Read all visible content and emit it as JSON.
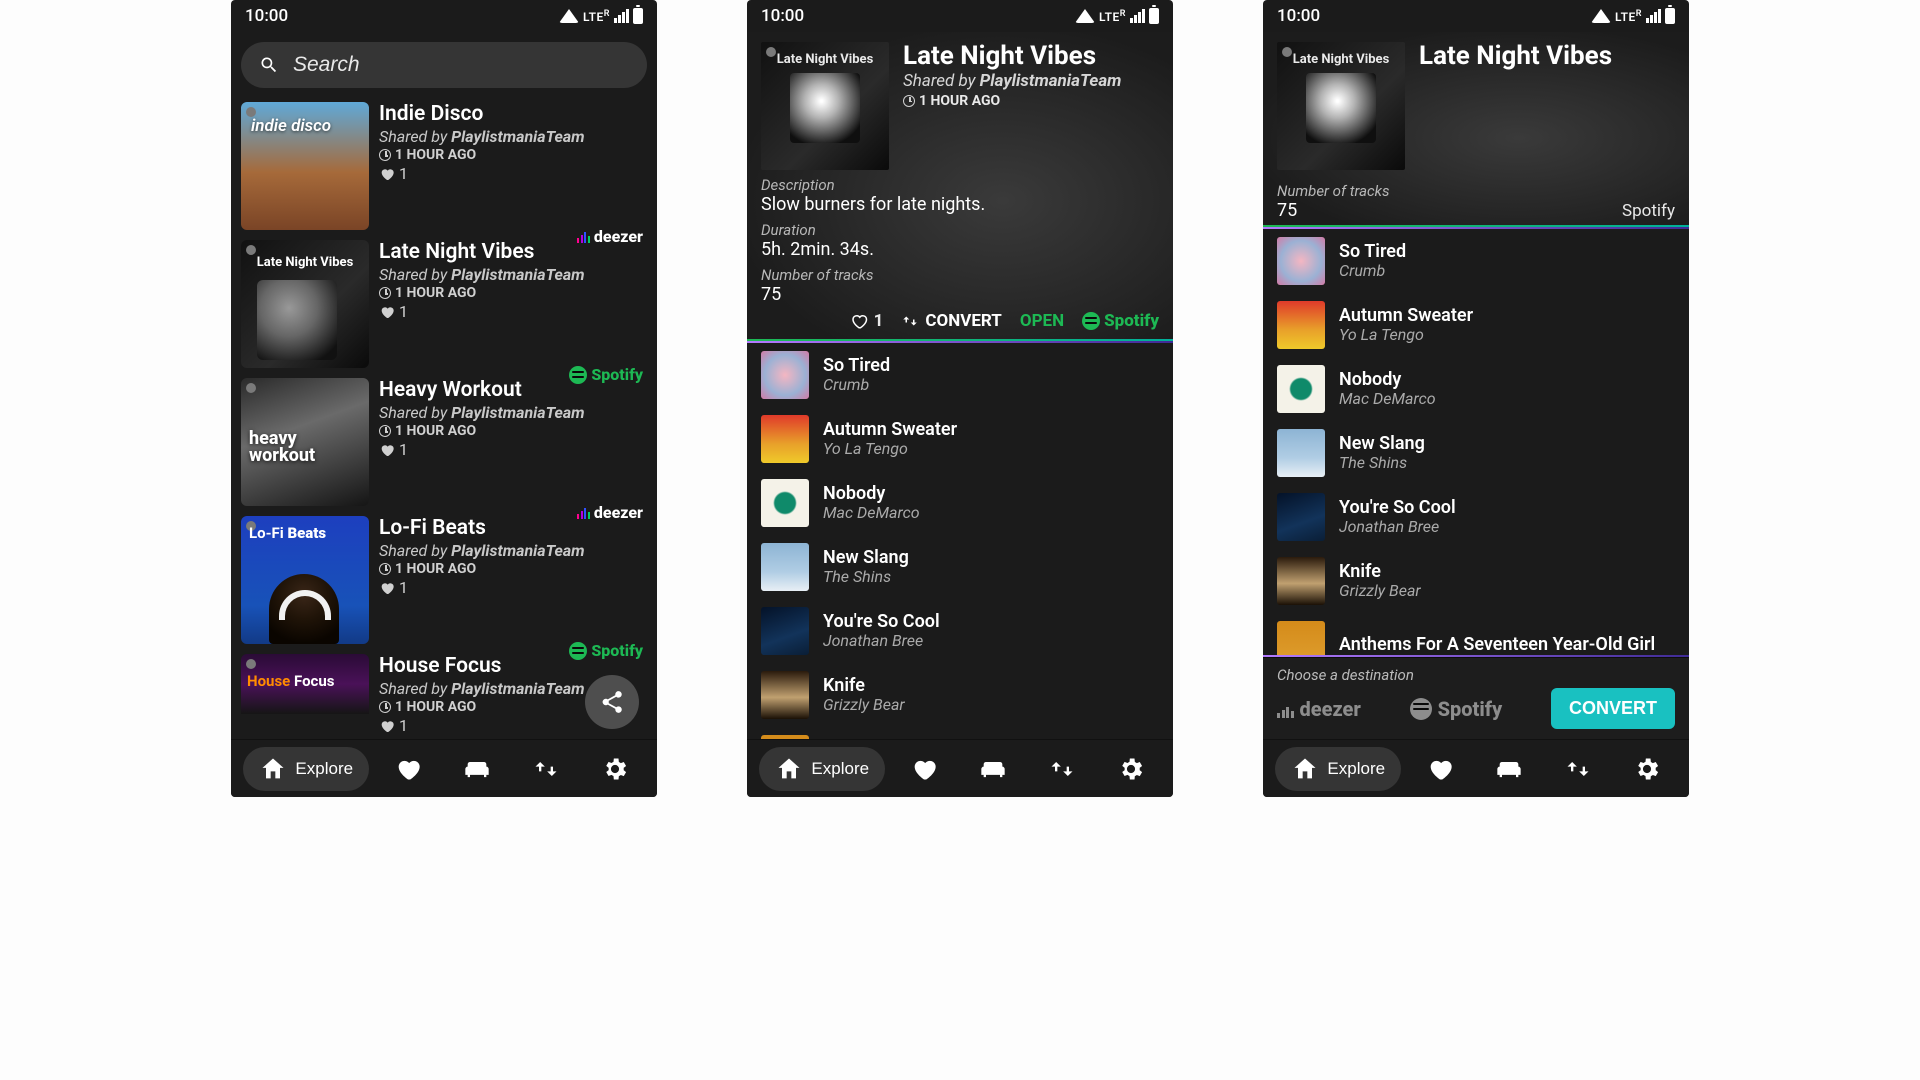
{
  "status": {
    "time": "10:00",
    "net": "LTE",
    "r": "R"
  },
  "search": {
    "placeholder": "Search"
  },
  "nav": {
    "explore": "Explore"
  },
  "playlists": [
    {
      "title": "Indie Disco",
      "sharedByLabel": "Shared by",
      "sharedBy": "PlaylistmaniaTeam",
      "ago": "1 HOUR AGO",
      "likes": "1",
      "service": "deezer",
      "artLabel": "indie disco"
    },
    {
      "title": "Late Night Vibes",
      "sharedByLabel": "Shared by",
      "sharedBy": "PlaylistmaniaTeam",
      "ago": "1 HOUR AGO",
      "likes": "1",
      "service": "spotify",
      "artLabel": "Late Night Vibes"
    },
    {
      "title": "Heavy Workout",
      "sharedByLabel": "Shared by",
      "sharedBy": "PlaylistmaniaTeam",
      "ago": "1 HOUR AGO",
      "likes": "1",
      "service": "deezer",
      "artLabel": "heavy\nworkout"
    },
    {
      "title": "Lo-Fi Beats",
      "sharedByLabel": "Shared by",
      "sharedBy": "PlaylistmaniaTeam",
      "ago": "1 HOUR AGO",
      "likes": "1",
      "service": "spotify",
      "artLabel": "Lo-Fi Beats"
    },
    {
      "title": "House Focus",
      "sharedByLabel": "Shared by",
      "sharedBy": "PlaylistmaniaTeam",
      "ago": "1 HOUR AGO",
      "likes": "1",
      "service": "",
      "artLabel": "House Focus"
    }
  ],
  "svc": {
    "spotify": "Spotify",
    "deezer": "deezer"
  },
  "detail": {
    "title": "Late Night Vibes",
    "artLabel": "Late Night Vibes",
    "sharedByLabel": "Shared by",
    "sharedBy": "PlaylistmaniaTeam",
    "ago": "1 HOUR AGO",
    "descLabel": "Description",
    "desc": "Slow burners for late nights.",
    "durLabel": "Duration",
    "dur": "5h. 2min. 34s.",
    "ntracksLabel": "Number of tracks",
    "ntracks": "75",
    "likes": "1",
    "convert": "CONVERT",
    "open": "OPEN"
  },
  "tracks": [
    {
      "t": "So Tired",
      "a": "Crumb"
    },
    {
      "t": "Autumn Sweater",
      "a": "Yo La Tengo"
    },
    {
      "t": "Nobody",
      "a": "Mac DeMarco"
    },
    {
      "t": "New Slang",
      "a": "The Shins"
    },
    {
      "t": "You're So Cool",
      "a": "Jonathan Bree"
    },
    {
      "t": "Knife",
      "a": "Grizzly Bear"
    },
    {
      "t": "Anthems For A Seventeen Year-Old Girl",
      "a": ""
    }
  ],
  "dest": {
    "label": "Choose a destination",
    "convert": "CONVERT"
  }
}
